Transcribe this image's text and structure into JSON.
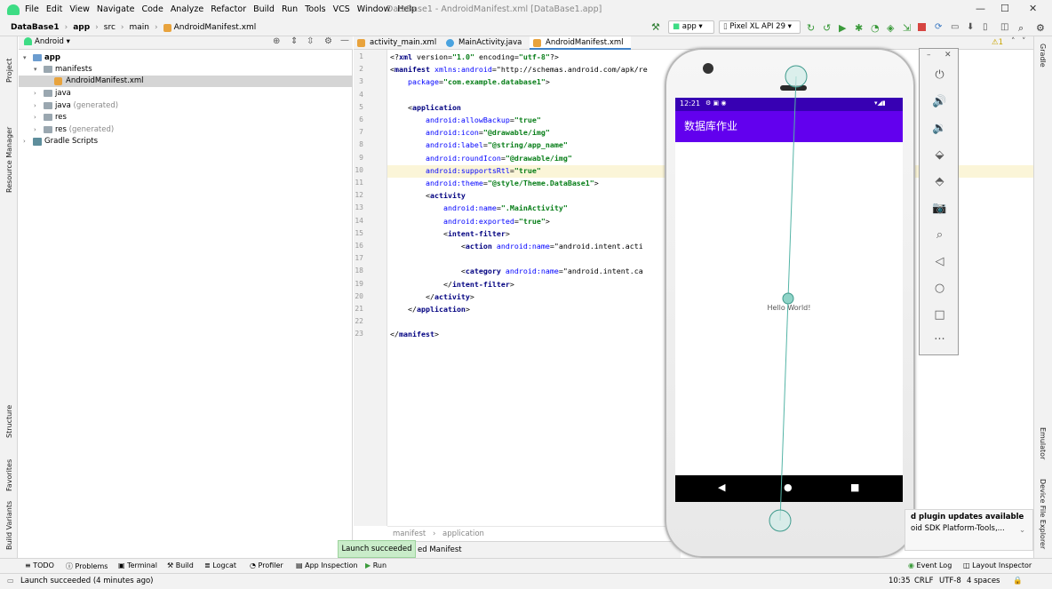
{
  "menu": {
    "items": [
      "File",
      "Edit",
      "View",
      "Navigate",
      "Code",
      "Analyze",
      "Refactor",
      "Build",
      "Run",
      "Tools",
      "VCS",
      "Window",
      "Help"
    ],
    "title": "DataBase1 - AndroidManifest.xml [DataBase1.app]"
  },
  "nav": {
    "breadcrumbs": [
      "DataBase1",
      "app",
      "src",
      "main",
      "AndroidManifest.xml"
    ],
    "run_config": "app",
    "device": "Pixel XL API 29"
  },
  "project": {
    "view": "Android",
    "tree": [
      {
        "label": "app",
        "level": 0,
        "bold": true,
        "expanded": true
      },
      {
        "label": "manifests",
        "level": 1,
        "expanded": true
      },
      {
        "label": "AndroidManifest.xml",
        "level": 2,
        "selected": true
      },
      {
        "label": "java",
        "level": 1
      },
      {
        "label": "java",
        "suffix": "(generated)",
        "level": 1
      },
      {
        "label": "res",
        "level": 1
      },
      {
        "label": "res",
        "suffix": "(generated)",
        "level": 1
      },
      {
        "label": "Gradle Scripts",
        "level": 0
      }
    ]
  },
  "left_stripe": [
    "Project",
    "Resource Manager",
    "Structure",
    "Favorites",
    "Build Variants"
  ],
  "right_stripe": [
    "Gradle",
    "Emulator",
    "Device File Explorer"
  ],
  "tabs": [
    {
      "label": "activity_main.xml",
      "icon_color": "#e8a33d"
    },
    {
      "label": "MainActivity.java",
      "icon_color": "#4aa3df"
    },
    {
      "label": "AndroidManifest.xml",
      "icon_color": "#e8a33d",
      "active": true
    }
  ],
  "code_lines": [
    "<?xml version=\"1.0\" encoding=\"utf-8\"?>",
    "<manifest xmlns:android=\"http://schemas.android.com/apk/re",
    "    package=\"com.example.database1\">",
    "",
    "    <application",
    "        android:allowBackup=\"true\"",
    "        android:icon=\"@drawable/img\"",
    "        android:label=\"@string/app_name\"",
    "        android:roundIcon=\"@drawable/img\"",
    "        android:supportsRtl=\"true\"",
    "        android:theme=\"@style/Theme.DataBase1\">",
    "        <activity",
    "            android:name=\".MainActivity\"",
    "            android:exported=\"true\">",
    "            <intent-filter>",
    "                <action android:name=\"android.intent.acti",
    "",
    "                <category android:name=\"android.intent.ca",
    "            </intent-filter>",
    "        </activity>",
    "    </application>",
    "",
    "</manifest>"
  ],
  "editor_breadcrumb": [
    "manifest",
    "application"
  ],
  "merged_manifest_tab": "ed Manifest",
  "warnings": "1",
  "phone": {
    "time": "12:21",
    "app_title": "数据库作业",
    "body_text": "Hello World!"
  },
  "notifications": {
    "toast": "Launch succeeded",
    "plugin_title": "d plugin updates available",
    "plugin_body": "oid SDK Platform-Tools,..."
  },
  "bottom_tools": [
    "TODO",
    "Problems",
    "Terminal",
    "Build",
    "Logcat",
    "Profiler",
    "App Inspection",
    "Run"
  ],
  "bottom_right_tools": [
    "Event Log",
    "Layout Inspector"
  ],
  "status": {
    "message": "Launch succeeded (4 minutes ago)",
    "position": "10:35",
    "line_sep": "CRLF",
    "encoding": "UTF-8",
    "indent": "4 spaces"
  }
}
